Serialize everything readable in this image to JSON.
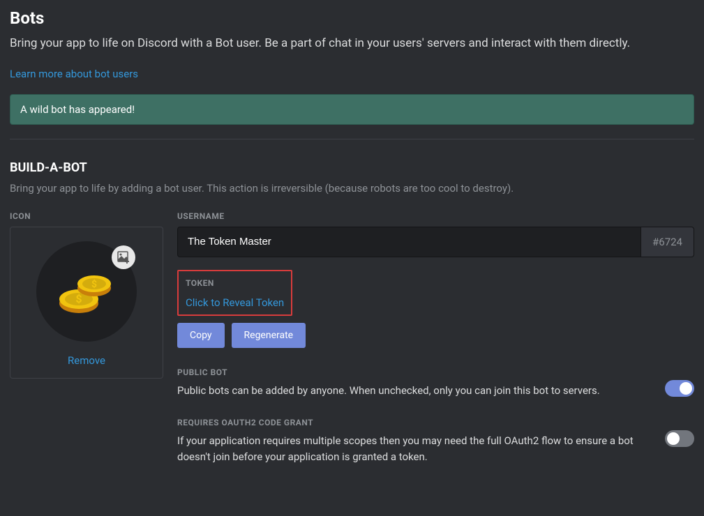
{
  "header": {
    "title": "Bots",
    "description": "Bring your app to life on Discord with a Bot user. Be a part of chat in your users' servers and interact with them directly.",
    "learn_more": "Learn more about bot users"
  },
  "banner": {
    "message": "A wild bot has appeared!"
  },
  "build": {
    "title": "BUILD-A-BOT",
    "description": "Bring your app to life by adding a bot user. This action is irreversible (because robots are too cool to destroy).",
    "icon_label": "ICON",
    "remove_label": "Remove",
    "username_label": "USERNAME",
    "username_value": "The Token Master",
    "discriminator": "#6724",
    "token_label": "TOKEN",
    "token_reveal": "Click to Reveal Token",
    "copy_btn": "Copy",
    "regenerate_btn": "Regenerate"
  },
  "settings": {
    "public_bot": {
      "label": "PUBLIC BOT",
      "description": "Public bots can be added by anyone. When unchecked, only you can join this bot to servers.",
      "enabled": true
    },
    "oauth2_grant": {
      "label": "REQUIRES OAUTH2 CODE GRANT",
      "description": "If your application requires multiple scopes then you may need the full OAuth2 flow to ensure a bot doesn't join before your application is granted a token.",
      "enabled": false
    }
  },
  "icons": {
    "upload": "image-add-icon",
    "avatar": "coins-icon"
  }
}
